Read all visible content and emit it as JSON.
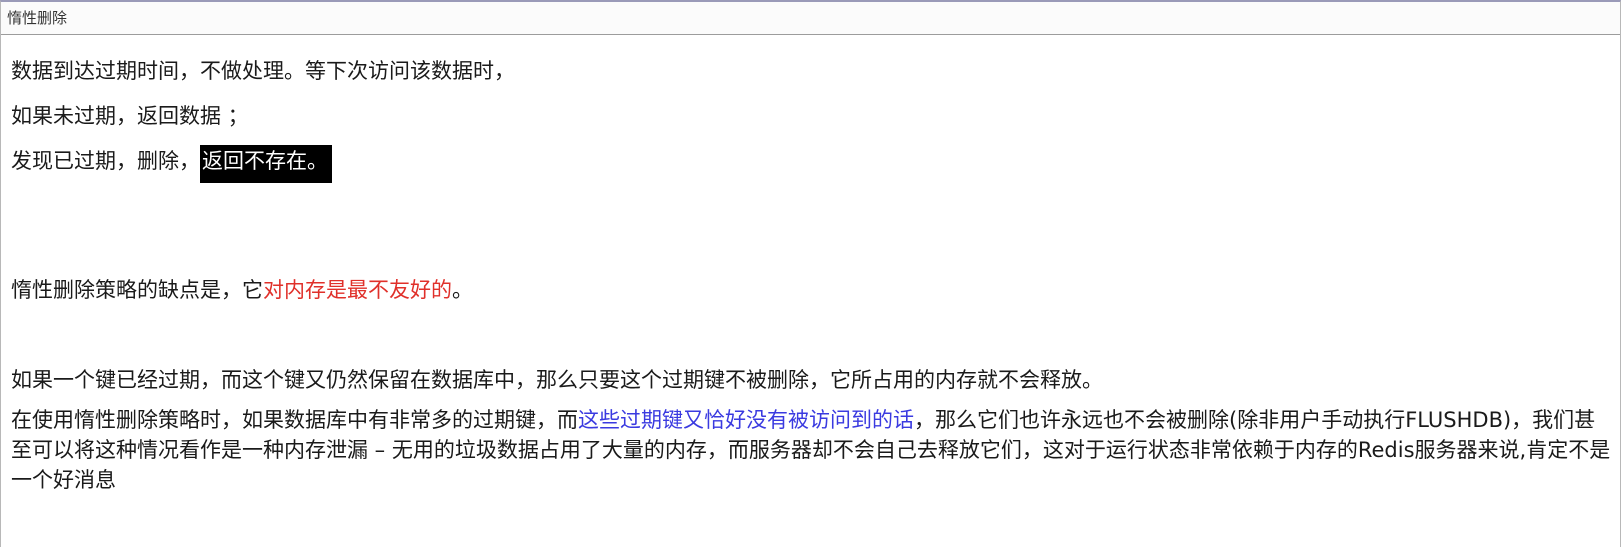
{
  "window": {
    "title": "惰性删除"
  },
  "section1": {
    "line1": "数据到达过期时间，不做处理。等下次访问该数据时，",
    "line2": "如果未过期，返回数据 ；",
    "line3_prefix": "发现已过期，删除，",
    "line3_highlight": "返回不存在。"
  },
  "section2": {
    "prefix": "惰性删除策略的缺点是，它",
    "emphasis": "对内存是最不友好的",
    "suffix": "。"
  },
  "section3": {
    "line1": "如果一个键已经过期，而这个键又仍然保留在数据库中，那么只要这个过期键不被删除，它所占用的内存就不会释放。",
    "para_prefix": "在使用惰性删除策略时，如果数据库中有非常多的过期键，而",
    "para_link": "这些过期键又恰好没有被访问到的话",
    "para_suffix": "，那么它们也许永远也不会被删除(除非用户手动执行FLUSHDB)，我们甚至可以将这种情况看作是一种内存泄漏 – 无用的垃圾数据占用了大量的内存，而服务器却不会自己去释放它们，这对于运行状态非常依赖于内存的Redis服务器来说,肯定不是一个好消息"
  },
  "colors": {
    "emphasis_red": "#e0302a",
    "link_blue": "#3a3ae0",
    "highlight_bg": "#000000"
  }
}
